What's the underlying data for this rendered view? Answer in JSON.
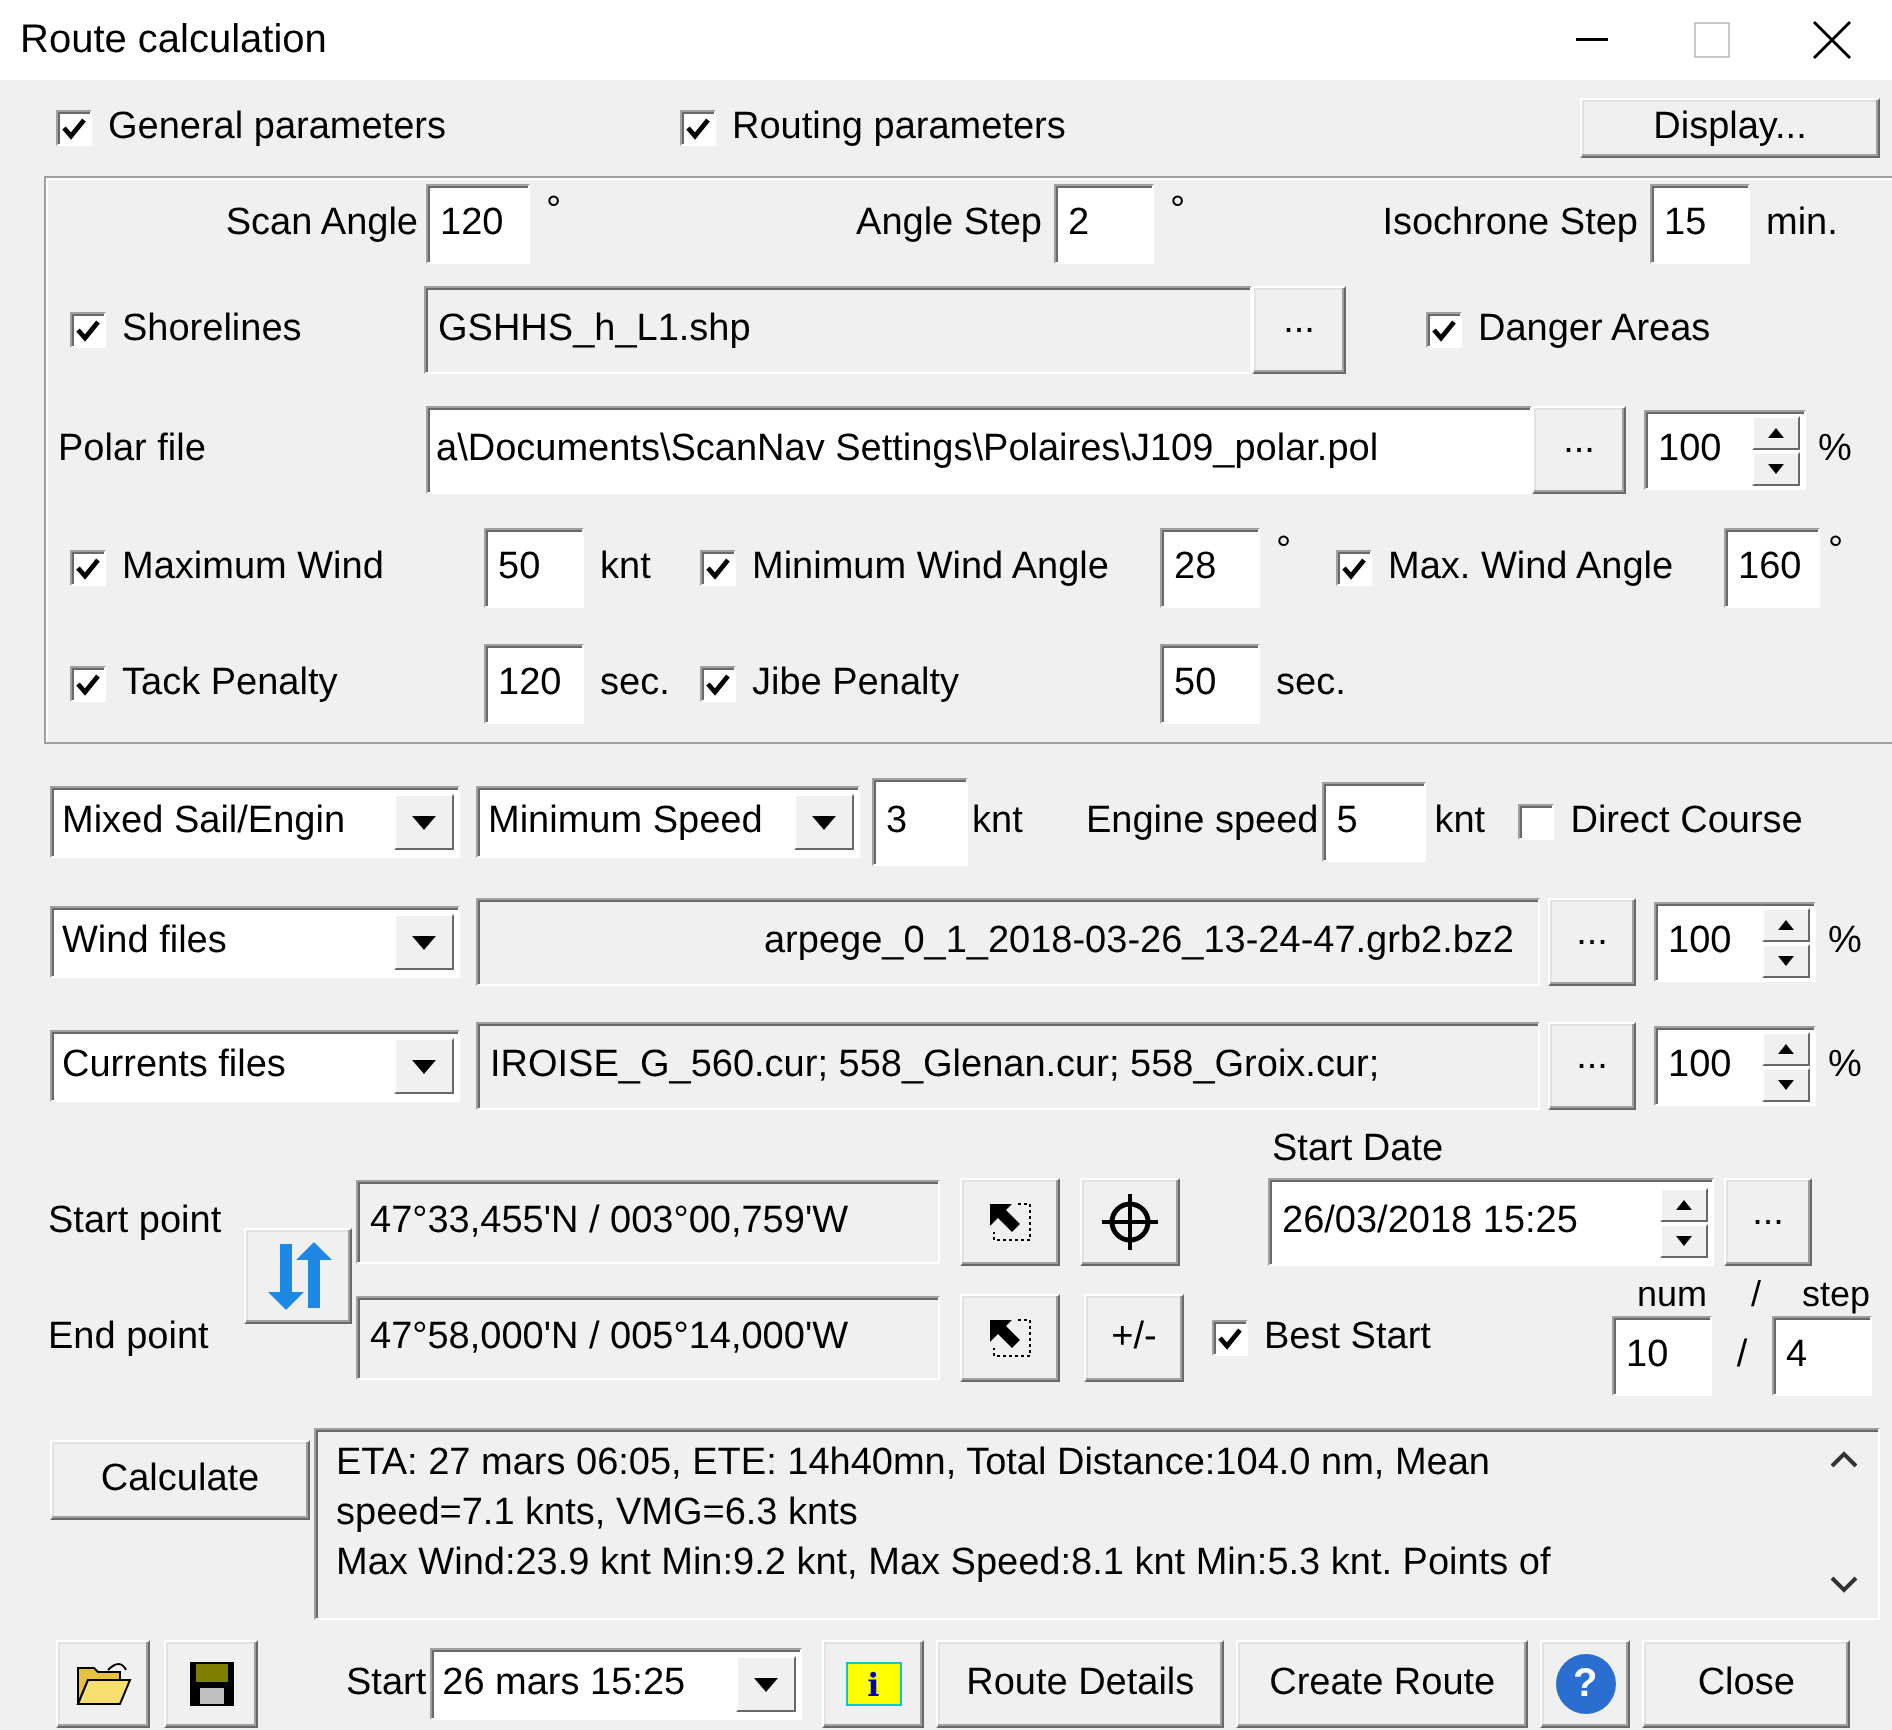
{
  "window": {
    "title": "Route calculation"
  },
  "sections": [
    {
      "label": "General parameters",
      "checked": true
    },
    {
      "label": "Routing parameters",
      "checked": true
    }
  ],
  "display_button": "Display...",
  "steps": [
    {
      "label": "Scan Angle",
      "value": "120",
      "unit": "°"
    },
    {
      "label": "Angle Step",
      "value": "2",
      "unit": "°"
    },
    {
      "label": "Isochrone Step",
      "value": "15",
      "unit": "min."
    }
  ],
  "shorelines": {
    "label": "Shorelines",
    "checked": true,
    "file": "GSHHS_h_L1.shp",
    "browse": "..."
  },
  "danger_areas": {
    "label": "Danger Areas",
    "checked": true
  },
  "polar": {
    "label": "Polar file",
    "file": "a\\Documents\\ScanNav Settings\\Polaires\\J109_polar.pol",
    "browse": "...",
    "percent": "100",
    "unit": "%"
  },
  "limits": [
    [
      {
        "label": "Maximum Wind",
        "checked": true,
        "value": "50",
        "unit": "knt"
      },
      {
        "label": "Minimum Wind Angle",
        "checked": true,
        "value": "28",
        "unit": "°"
      },
      {
        "label": "Max. Wind Angle",
        "checked": true,
        "value": "160",
        "unit": "°"
      }
    ],
    [
      {
        "label": "Tack Penalty",
        "checked": true,
        "value": "120",
        "unit": "sec."
      },
      {
        "label": "Jibe Penalty",
        "checked": true,
        "value": "50",
        "unit": "sec."
      }
    ]
  ],
  "motor": {
    "mode": "Mixed Sail/Engin",
    "speed_mode": "Minimum Speed",
    "speed": "3",
    "speed_unit": "knt",
    "engine_label": "Engine speed",
    "engine_speed": "5",
    "engine_unit": "knt",
    "direct_course": {
      "label": "Direct Course",
      "checked": false
    }
  },
  "files": [
    {
      "type": "Wind files",
      "value": "arpege_0_1_2018-03-26_13-24-47.grb2.bz2",
      "kind": "wind",
      "browse": "...",
      "percent": "100",
      "unit": "%"
    },
    {
      "type": "Currents files",
      "value": "IROISE_G_560.cur; 558_Glenan.cur; 558_Groix.cur;",
      "kind": "currents",
      "browse": "...",
      "percent": "100",
      "unit": "%"
    }
  ],
  "start_point": {
    "label": "Start point",
    "value": "47°33,455'N / 003°00,759'W"
  },
  "end_point": {
    "label": "End point",
    "value": "47°58,000'N / 005°14,000'W",
    "offset_button": "+/-"
  },
  "start_date": {
    "label": "Start Date",
    "value": "26/03/2018 15:25",
    "browse": "..."
  },
  "best_start": {
    "label": "Best Start",
    "checked": true,
    "num_label": "num",
    "label_separator": "/",
    "step_label": "step",
    "num": "10",
    "separator": "/",
    "step": "4"
  },
  "calculate_button": "Calculate",
  "result_lines": [
    "ETA: 27 mars 06:05, ETE: 14h40mn, Total Distance:104.0 nm, Mean",
    "speed=7.1 knts, VMG=6.3 knts",
    "Max Wind:23.9 knt Min:9.2 knt, Max Speed:8.1 knt Min:5.3 knt. Points of"
  ],
  "footer": {
    "start_label": "Start",
    "start_value": "26 mars 15:25",
    "info_button": "i",
    "buttons": [
      "Route Details",
      "Create Route"
    ],
    "help_button": "?",
    "close_button": "Close"
  }
}
